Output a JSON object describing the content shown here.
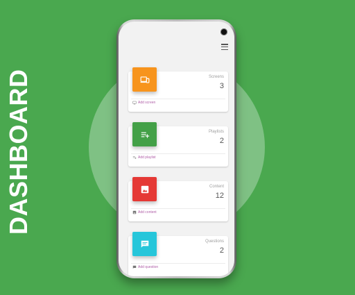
{
  "page_title": "DASHBOARD",
  "colors": {
    "background": "#4aa84f",
    "screens": "#f7941d",
    "playlists": "#43a047",
    "content": "#e53935",
    "questions": "#26c6da",
    "action_text": "#b05fa8"
  },
  "header": {
    "menu_icon": "hamburger-menu-icon"
  },
  "cards": [
    {
      "label": "Screens",
      "count": "3",
      "action": "Add screen",
      "icon": "devices-icon",
      "action_icon": "screen-icon"
    },
    {
      "label": "Playlists",
      "count": "2",
      "action": "Add playlist",
      "icon": "playlist-add-icon",
      "action_icon": "playlist-icon"
    },
    {
      "label": "Content",
      "count": "12",
      "action": "Add content",
      "icon": "image-icon",
      "action_icon": "image-small-icon"
    },
    {
      "label": "Questions",
      "count": "2",
      "action": "Add question",
      "icon": "chat-icon",
      "action_icon": "chat-small-icon"
    }
  ]
}
